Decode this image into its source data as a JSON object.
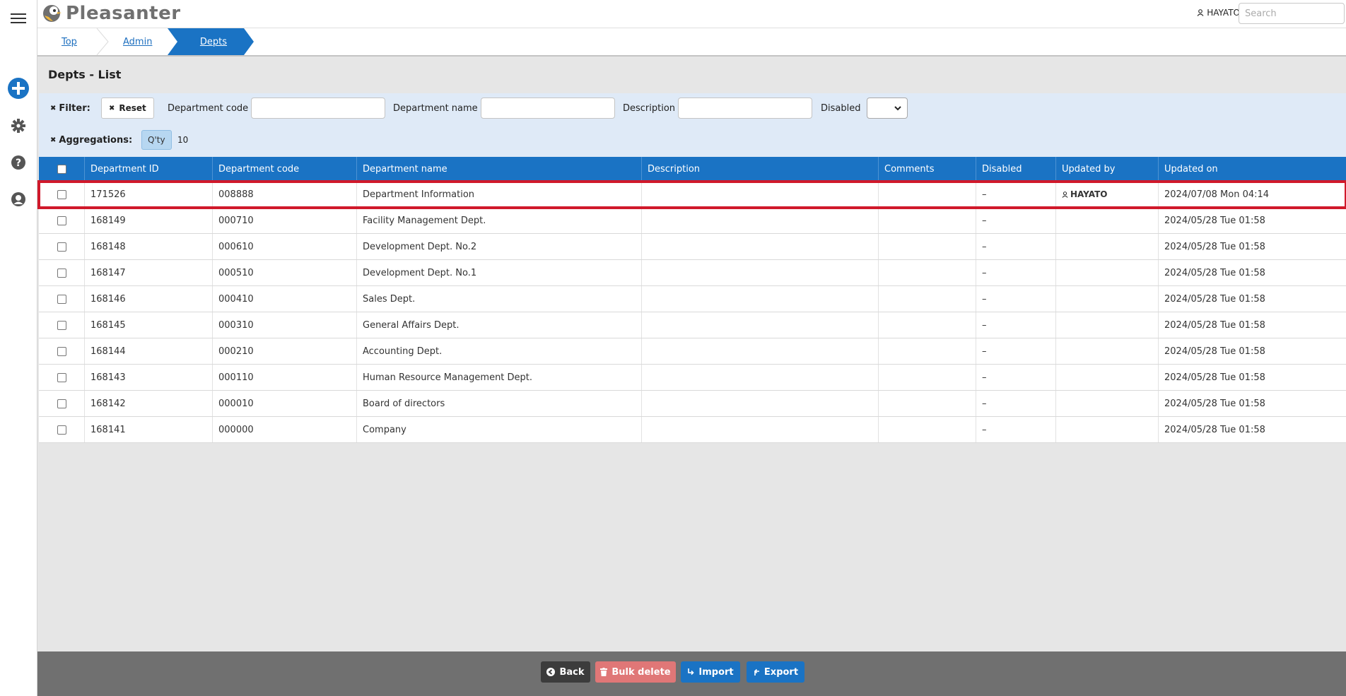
{
  "app": {
    "logo_text": "Pleasanter"
  },
  "header": {
    "user_name": "HAYATO",
    "search_placeholder": "Search"
  },
  "rail": {
    "icons": [
      "menu-icon",
      "plus-icon",
      "gear-icon",
      "help-icon",
      "user-icon"
    ]
  },
  "breadcrumb": {
    "top": "Top",
    "admin": "Admin",
    "current": "Depts"
  },
  "page": {
    "title": "Depts - List"
  },
  "filter": {
    "label": "Filter:",
    "reset": "Reset",
    "dept_code_label": "Department code",
    "dept_name_label": "Department name",
    "description_label": "Description",
    "disabled_label": "Disabled"
  },
  "aggregations": {
    "label": "Aggregations:",
    "qty_label": "Q'ty",
    "qty_value": "10"
  },
  "table": {
    "columns": [
      "Department ID",
      "Department code",
      "Department name",
      "Description",
      "Comments",
      "Disabled",
      "Updated by",
      "Updated on"
    ],
    "rows": [
      {
        "id": "171526",
        "code": "008888",
        "name": "Department Information",
        "description": "",
        "comments": "",
        "disabled": "–",
        "updated_by": "HAYATO",
        "updated_on": "2024/07/08 Mon 04:14",
        "highlighted": true
      },
      {
        "id": "168149",
        "code": "000710",
        "name": "Facility Management Dept.",
        "description": "",
        "comments": "",
        "disabled": "–",
        "updated_by": "",
        "updated_on": "2024/05/28 Tue 01:58"
      },
      {
        "id": "168148",
        "code": "000610",
        "name": "Development Dept. No.2",
        "description": "",
        "comments": "",
        "disabled": "–",
        "updated_by": "",
        "updated_on": "2024/05/28 Tue 01:58"
      },
      {
        "id": "168147",
        "code": "000510",
        "name": "Development Dept. No.1",
        "description": "",
        "comments": "",
        "disabled": "–",
        "updated_by": "",
        "updated_on": "2024/05/28 Tue 01:58"
      },
      {
        "id": "168146",
        "code": "000410",
        "name": "Sales Dept.",
        "description": "",
        "comments": "",
        "disabled": "–",
        "updated_by": "",
        "updated_on": "2024/05/28 Tue 01:58"
      },
      {
        "id": "168145",
        "code": "000310",
        "name": "General Affairs Dept.",
        "description": "",
        "comments": "",
        "disabled": "–",
        "updated_by": "",
        "updated_on": "2024/05/28 Tue 01:58"
      },
      {
        "id": "168144",
        "code": "000210",
        "name": "Accounting Dept.",
        "description": "",
        "comments": "",
        "disabled": "–",
        "updated_by": "",
        "updated_on": "2024/05/28 Tue 01:58"
      },
      {
        "id": "168143",
        "code": "000110",
        "name": "Human Resource Management Dept.",
        "description": "",
        "comments": "",
        "disabled": "–",
        "updated_by": "",
        "updated_on": "2024/05/28 Tue 01:58"
      },
      {
        "id": "168142",
        "code": "000010",
        "name": "Board of directors",
        "description": "",
        "comments": "",
        "disabled": "–",
        "updated_by": "",
        "updated_on": "2024/05/28 Tue 01:58"
      },
      {
        "id": "168141",
        "code": "000000",
        "name": "Company",
        "description": "",
        "comments": "",
        "disabled": "–",
        "updated_by": "",
        "updated_on": "2024/05/28 Tue 01:58"
      }
    ]
  },
  "commands": {
    "back": "Back",
    "bulk_delete": "Bulk delete",
    "import": "Import",
    "export": "Export"
  },
  "colors": {
    "primary": "#1a73c4",
    "highlight": "#d0192b",
    "filter_bg": "#dfeaf7",
    "command_bar": "#707070"
  }
}
